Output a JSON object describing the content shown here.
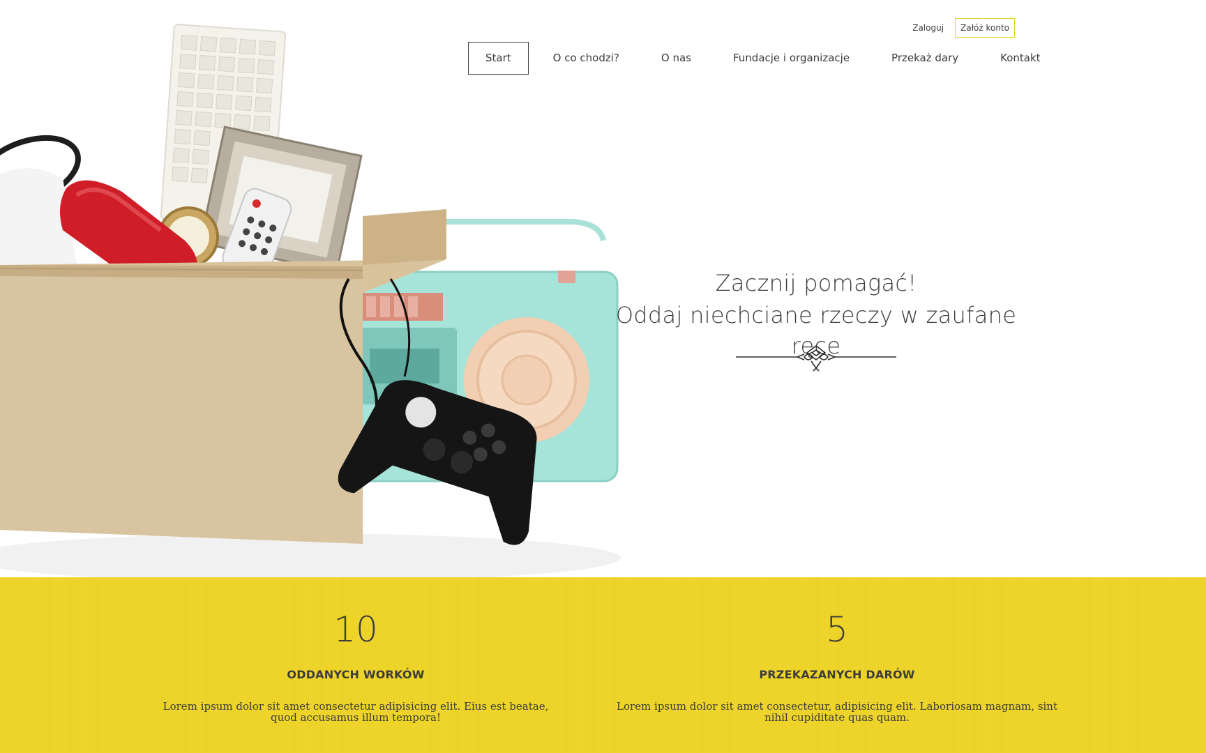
{
  "header": {
    "auth": {
      "login_label": "Zaloguj",
      "register_label": "Załóż konto"
    },
    "nav": [
      {
        "label": "Start",
        "active": true
      },
      {
        "label": "O co chodzi?"
      },
      {
        "label": "O nas"
      },
      {
        "label": "Fundacje i organizacje"
      },
      {
        "label": "Przekaż dary"
      },
      {
        "label": "Kontakt"
      }
    ]
  },
  "hero": {
    "line1": "Zacznij pomagać!",
    "line2": "Oddaj niechciane rzeczy w zaufane ręce",
    "image_icon": "donation-box-illustration",
    "ornament_icon": "decorative-divider-icon"
  },
  "stats": [
    {
      "number": "10",
      "label": "ODDANYCH WORKÓW",
      "description": "Lorem ipsum dolor sit amet consectetur adipisicing elit. Eius est beatae, quod accusamus illum tempora!"
    },
    {
      "number": "5",
      "label": "PRZEKAZANYCH DARÓW",
      "description": "Lorem ipsum dolor sit amet consectetur, adipisicing elit. Laboriosam magnam, sint nihil cupiditate quas quam."
    }
  ],
  "colors": {
    "accent": "#efd52a",
    "text": "#3c3c3c",
    "register_border": "#e2d12a"
  }
}
